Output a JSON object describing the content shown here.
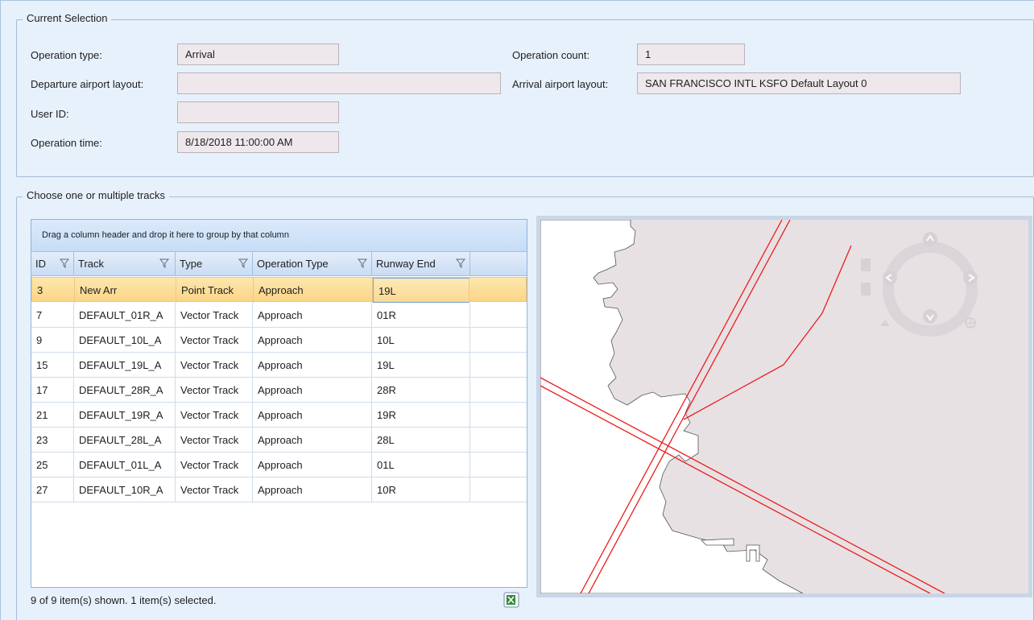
{
  "current_selection": {
    "legend": "Current Selection",
    "operation_type_label": "Operation type:",
    "operation_type_value": "Arrival",
    "departure_layout_label": "Departure airport layout:",
    "departure_layout_value": "",
    "user_id_label": "User ID:",
    "user_id_value": "",
    "operation_time_label": "Operation time:",
    "operation_time_value": "8/18/2018 11:00:00 AM",
    "operation_count_label": "Operation count:",
    "operation_count_value": "1",
    "arrival_layout_label": "Arrival airport layout:",
    "arrival_layout_value": "SAN FRANCISCO INTL KSFO Default Layout 0"
  },
  "tracks": {
    "legend": "Choose one or multiple tracks",
    "group_panel_hint": "Drag a column header and drop it here to group by that column",
    "columns": [
      "ID",
      "Track",
      "Type",
      "Operation Type",
      "Runway End"
    ],
    "rows": [
      {
        "id": "3",
        "track": "New Arr",
        "type": "Point Track",
        "operation_type": "Approach",
        "runway_end": "19L"
      },
      {
        "id": "7",
        "track": "DEFAULT_01R_A",
        "type": "Vector Track",
        "operation_type": "Approach",
        "runway_end": "01R"
      },
      {
        "id": "9",
        "track": "DEFAULT_10L_A",
        "type": "Vector Track",
        "operation_type": "Approach",
        "runway_end": "10L"
      },
      {
        "id": "15",
        "track": "DEFAULT_19L_A",
        "type": "Vector Track",
        "operation_type": "Approach",
        "runway_end": "19L"
      },
      {
        "id": "17",
        "track": "DEFAULT_28R_A",
        "type": "Vector Track",
        "operation_type": "Approach",
        "runway_end": "28R"
      },
      {
        "id": "21",
        "track": "DEFAULT_19R_A",
        "type": "Vector Track",
        "operation_type": "Approach",
        "runway_end": "19R"
      },
      {
        "id": "23",
        "track": "DEFAULT_28L_A",
        "type": "Vector Track",
        "operation_type": "Approach",
        "runway_end": "28L"
      },
      {
        "id": "25",
        "track": "DEFAULT_01L_A",
        "type": "Vector Track",
        "operation_type": "Approach",
        "runway_end": "01L"
      },
      {
        "id": "27",
        "track": "DEFAULT_10R_A",
        "type": "Vector Track",
        "operation_type": "Approach",
        "runway_end": "10R"
      }
    ],
    "selected_row_index": 0,
    "status": "9 of 9 item(s) shown. 1 item(s) selected."
  },
  "map": {
    "track_color": "#ee1c1c",
    "land_color": "#ffffff",
    "water_color": "#e7e1e4",
    "nav_icons": [
      "pan-up-icon",
      "pan-down-icon",
      "pan-left-icon",
      "pan-right-icon",
      "zoom-in-icon",
      "zoom-out-icon",
      "globe-icon"
    ]
  },
  "icons": {
    "filter": "filter-icon",
    "export": "excel-export-icon"
  }
}
